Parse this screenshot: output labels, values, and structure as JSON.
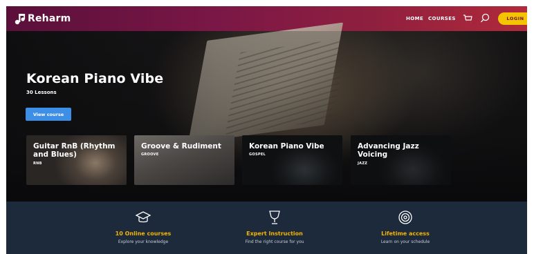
{
  "brand": {
    "name": "Reharm",
    "logo_icon": "music-note-icon"
  },
  "nav": {
    "home_label": "HOME",
    "courses_label": "COURSES",
    "cart_icon": "cart-icon",
    "search_icon": "search-icon",
    "login_label": "LOGIN"
  },
  "hero": {
    "title": "Korean Piano Vibe",
    "subtitle": "30 Lessons",
    "cta_label": "View course"
  },
  "courses": [
    {
      "title": "Guitar RnB (Rhythm and Blues)",
      "tag": "RNB"
    },
    {
      "title": "Groove & Rudiment",
      "tag": "GROOVE"
    },
    {
      "title": "Korean Piano Vibe",
      "tag": "GOSPEL"
    },
    {
      "title": "Advancing Jazz Voicing",
      "tag": "JAZZ"
    }
  ],
  "features": [
    {
      "icon": "graduation-cap-icon",
      "title": "10 Online courses",
      "subtitle": "Explore your knowledge"
    },
    {
      "icon": "trophy-icon",
      "title": "Expert Instruction",
      "subtitle": "Find the right course for you"
    },
    {
      "icon": "target-icon",
      "title": "Lifetime access",
      "subtitle": "Learn on your schedule"
    }
  ],
  "colors": {
    "nav_gradient_start": "#5a0f3a",
    "nav_gradient_end": "#b02a3a",
    "login_button": "#f5c400",
    "cta_button": "#3d8fe6",
    "feature_accent": "#f5b400",
    "features_background": "#1d2a3c"
  }
}
